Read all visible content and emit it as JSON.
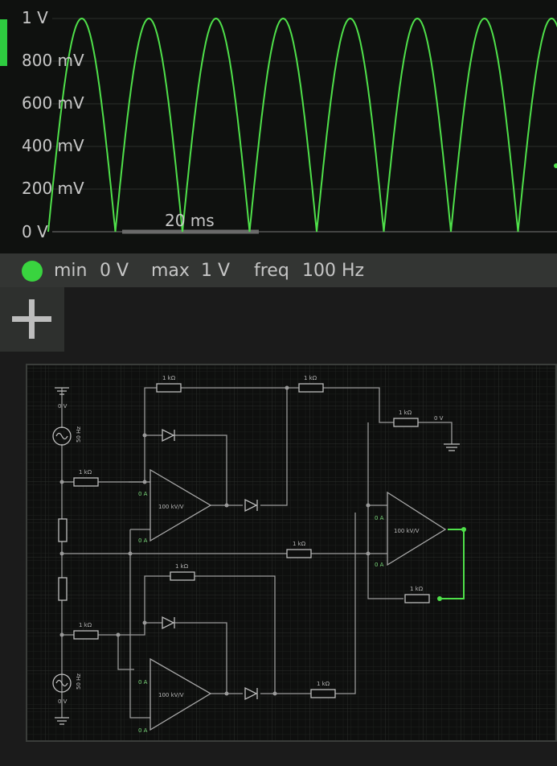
{
  "scope": {
    "y_labels": [
      "1 V",
      "800 mV",
      "600 mV",
      "400 mV",
      "200 mV",
      "0 V"
    ],
    "timescale": "20 ms",
    "trace_color": "#4fe04a"
  },
  "chart_data": {
    "type": "line",
    "series": [
      {
        "x": [
          0,
          0.005,
          0.01,
          0.015,
          0.02,
          0.025,
          0.03,
          0.035,
          0.04,
          0.045,
          0.05,
          0.055,
          0.06,
          0.065,
          0.07,
          0.075,
          0.08
        ],
        "values": [
          0,
          1,
          0,
          1,
          0,
          1,
          0,
          1,
          0,
          1,
          0,
          1,
          0,
          1,
          0,
          1,
          0
        ]
      }
    ],
    "ylim": [
      0,
      1
    ]
  },
  "status": {
    "min_label": "min",
    "min_value": "0 V",
    "max_label": "max",
    "max_value": "1 V",
    "freq_label": "freq",
    "freq_value": "100 Hz",
    "dot_color": "#39d43f"
  },
  "add_button": {
    "icon": "plus-icon"
  },
  "circuit": {
    "resistors": [
      "1 kΩ",
      "1 kΩ",
      "1 kΩ",
      "1 kΩ",
      "1 kΩ",
      "1 kΩ",
      "1 kΩ",
      "1 kΩ",
      "1 kΩ",
      "1 kΩ",
      "1 kΩ"
    ],
    "opamp_gain": "100 kV/V",
    "source_freq": "50 Hz",
    "zero_v": "0 V",
    "zero_a": "0 A"
  }
}
